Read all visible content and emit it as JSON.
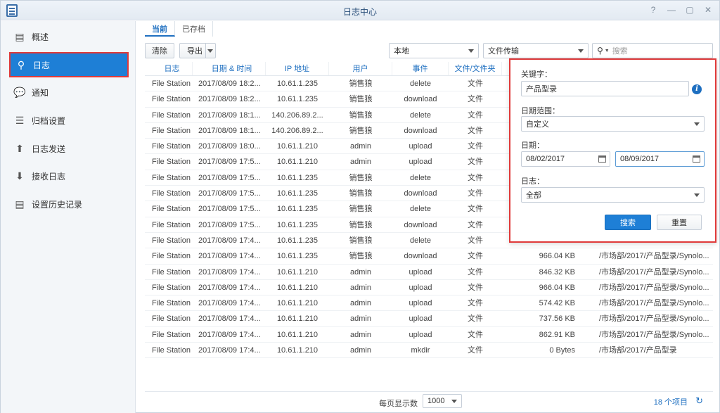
{
  "window": {
    "title": "日志中心",
    "controls": [
      "?",
      "—",
      "▢",
      "✕"
    ]
  },
  "sidebar": {
    "items": [
      {
        "label": "概述",
        "icon": "overview-icon",
        "glyph": "▤"
      },
      {
        "label": "日志",
        "icon": "search-icon",
        "glyph": "⚲",
        "active": true
      },
      {
        "label": "通知",
        "icon": "chat-icon",
        "glyph": "💬"
      },
      {
        "label": "归档设置",
        "icon": "archive-icon",
        "glyph": "☰"
      },
      {
        "label": "日志发送",
        "icon": "log-send-icon",
        "glyph": "⬆"
      },
      {
        "label": "接收日志",
        "icon": "log-receive-icon",
        "glyph": "⬇"
      },
      {
        "label": "设置历史记录",
        "icon": "history-icon",
        "glyph": "▤"
      }
    ]
  },
  "tabs": [
    {
      "label": "当前",
      "active": true
    },
    {
      "label": "已存档"
    }
  ],
  "toolbar": {
    "clear_label": "清除",
    "export_label": "导出",
    "source_select": "本地",
    "type_select": "文件传输",
    "search_placeholder": "搜索"
  },
  "table": {
    "columns": [
      "日志",
      "日期 & 时间",
      "IP 地址",
      "用户",
      "事件",
      "文件/文件夹",
      "",
      ""
    ],
    "rows": [
      [
        "File Station",
        "2017/08/09 18:2...",
        "10.61.1.235",
        "销售狼",
        "delete",
        "文件",
        "",
        ""
      ],
      [
        "File Station",
        "2017/08/09 18:2...",
        "10.61.1.235",
        "销售狼",
        "download",
        "文件",
        "",
        ""
      ],
      [
        "File Station",
        "2017/08/09 18:1...",
        "140.206.89.2...",
        "销售狼",
        "delete",
        "文件",
        "",
        ""
      ],
      [
        "File Station",
        "2017/08/09 18:1...",
        "140.206.89.2...",
        "销售狼",
        "download",
        "文件",
        "",
        ""
      ],
      [
        "File Station",
        "2017/08/09 18:0...",
        "10.61.1.210",
        "admin",
        "upload",
        "文件",
        "",
        ""
      ],
      [
        "File Station",
        "2017/08/09 17:5...",
        "10.61.1.210",
        "admin",
        "upload",
        "文件",
        "",
        ""
      ],
      [
        "File Station",
        "2017/08/09 17:5...",
        "10.61.1.235",
        "销售狼",
        "delete",
        "文件",
        "",
        ""
      ],
      [
        "File Station",
        "2017/08/09 17:5...",
        "10.61.1.235",
        "销售狼",
        "download",
        "文件",
        "",
        ""
      ],
      [
        "File Station",
        "2017/08/09 17:5...",
        "10.61.1.235",
        "销售狼",
        "delete",
        "文件",
        "",
        ""
      ],
      [
        "File Station",
        "2017/08/09 17:5...",
        "10.61.1.235",
        "销售狼",
        "download",
        "文件",
        "",
        ""
      ],
      [
        "File Station",
        "2017/08/09 17:4...",
        "10.61.1.235",
        "销售狼",
        "delete",
        "文件",
        "",
        ""
      ],
      [
        "File Station",
        "2017/08/09 17:4...",
        "10.61.1.235",
        "销售狼",
        "download",
        "文件",
        "966.04 KB",
        "/市场部/2017/产品型录/Synolo..."
      ],
      [
        "File Station",
        "2017/08/09 17:4...",
        "10.61.1.210",
        "admin",
        "upload",
        "文件",
        "846.32 KB",
        "/市场部/2017/产品型录/Synolo..."
      ],
      [
        "File Station",
        "2017/08/09 17:4...",
        "10.61.1.210",
        "admin",
        "upload",
        "文件",
        "966.04 KB",
        "/市场部/2017/产品型录/Synolo..."
      ],
      [
        "File Station",
        "2017/08/09 17:4...",
        "10.61.1.210",
        "admin",
        "upload",
        "文件",
        "574.42 KB",
        "/市场部/2017/产品型录/Synolo..."
      ],
      [
        "File Station",
        "2017/08/09 17:4...",
        "10.61.1.210",
        "admin",
        "upload",
        "文件",
        "737.56 KB",
        "/市场部/2017/产品型录/Synolo..."
      ],
      [
        "File Station",
        "2017/08/09 17:4...",
        "10.61.1.210",
        "admin",
        "upload",
        "文件",
        "862.91 KB",
        "/市场部/2017/产品型录/Synolo..."
      ],
      [
        "File Station",
        "2017/08/09 17:4...",
        "10.61.1.210",
        "admin",
        "mkdir",
        "文件",
        "0 Bytes",
        "/市场部/2017/产品型录"
      ]
    ]
  },
  "footer": {
    "per_page_label": "每页显示数",
    "per_page_value": "1000",
    "item_count": "18 个项目"
  },
  "popup": {
    "keyword_label": "关键字：",
    "keyword_value": "产品型录",
    "date_range_label": "日期范围：",
    "date_range_value": "自定义",
    "date_label": "日期：",
    "date_from": "08/02/2017",
    "date_to": "08/09/2017",
    "log_label": "日志：",
    "log_value": "全部",
    "search_button": "搜索",
    "reset_button": "重置"
  },
  "colors": {
    "accent": "#1e7fd6",
    "highlight_border": "#e03a3a"
  }
}
